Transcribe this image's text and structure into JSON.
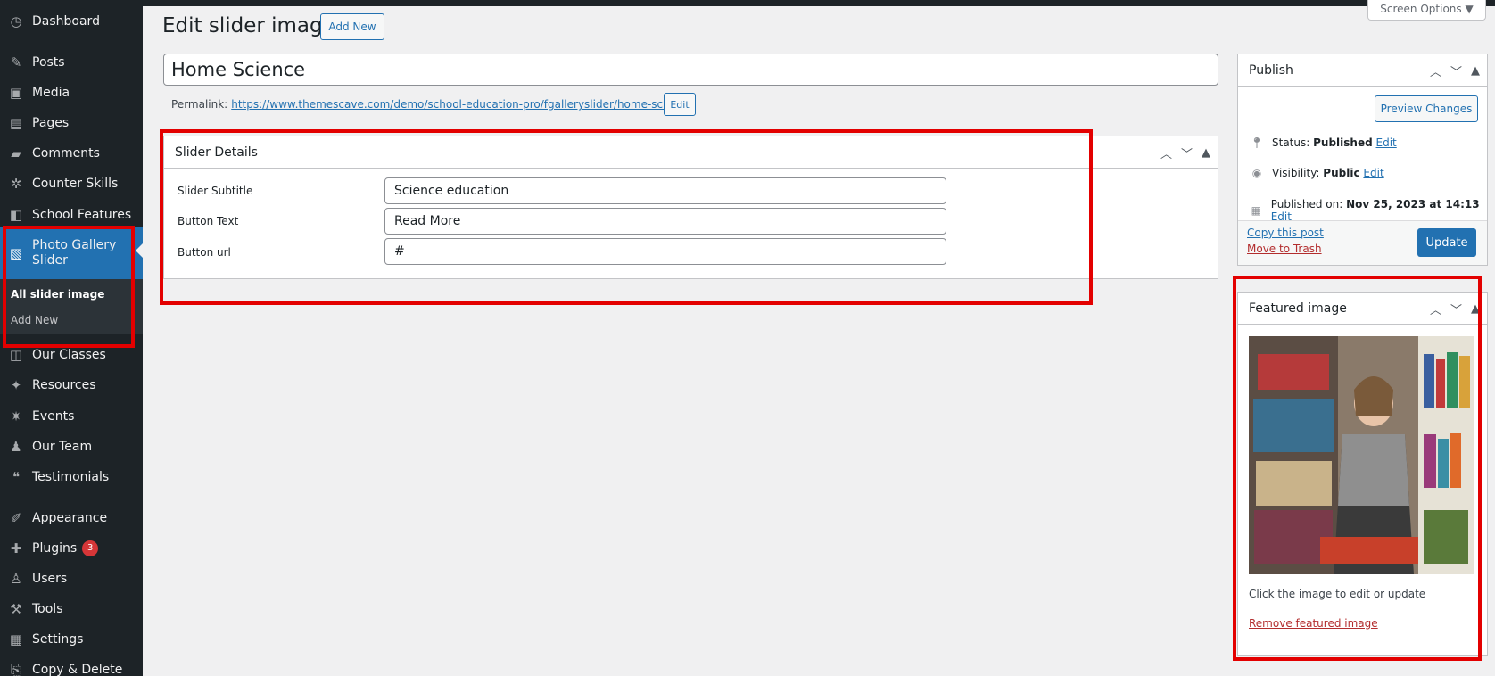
{
  "sidebar": {
    "items": [
      {
        "label": "Dashboard",
        "icon": "dashboard-icon",
        "glyph": "◷"
      },
      {
        "label": "Posts",
        "icon": "pin-icon",
        "glyph": "✎"
      },
      {
        "label": "Media",
        "icon": "media-icon",
        "glyph": "▣"
      },
      {
        "label": "Pages",
        "icon": "pages-icon",
        "glyph": "▤"
      },
      {
        "label": "Comments",
        "icon": "comment-icon",
        "glyph": "▰"
      },
      {
        "label": "Counter Skills",
        "icon": "skills-icon",
        "glyph": "✲"
      },
      {
        "label": "School Features",
        "icon": "features-icon",
        "glyph": "◧"
      },
      {
        "label": "Photo Gallery Slider",
        "icon": "gallery-icon",
        "glyph": "▧"
      },
      {
        "label": "Our Classes",
        "icon": "classes-icon",
        "glyph": "◫"
      },
      {
        "label": "Resources",
        "icon": "resources-icon",
        "glyph": "✦"
      },
      {
        "label": "Events",
        "icon": "events-icon",
        "glyph": "✷"
      },
      {
        "label": "Our Team",
        "icon": "team-icon",
        "glyph": "♟"
      },
      {
        "label": "Testimonials",
        "icon": "quote-icon",
        "glyph": "❝"
      },
      {
        "label": "Appearance",
        "icon": "appearance-icon",
        "glyph": "✐"
      },
      {
        "label": "Plugins",
        "icon": "plugins-icon",
        "glyph": "✚",
        "badge": "3"
      },
      {
        "label": "Users",
        "icon": "users-icon",
        "glyph": "♙"
      },
      {
        "label": "Tools",
        "icon": "tools-icon",
        "glyph": "⚒"
      },
      {
        "label": "Settings",
        "icon": "settings-icon",
        "glyph": "▦"
      },
      {
        "label": "Copy & Delete",
        "icon": "copy-icon",
        "glyph": "⎘"
      }
    ],
    "submenu": {
      "all_label": "All slider image",
      "add_label": "Add New"
    }
  },
  "header": {
    "title": "Edit slider image",
    "add_new": "Add New",
    "screen_options": "Screen Options ▼"
  },
  "post": {
    "title": "Home Science",
    "permalink_label": "Permalink:",
    "permalink_url": "https://www.themescave.com/demo/school-education-pro/fgalleryslider/home-science/",
    "permalink_edit": "Edit"
  },
  "slider_details": {
    "heading": "Slider Details",
    "fields": [
      {
        "label": "Slider Subtitle",
        "value": "Science education"
      },
      {
        "label": "Button Text",
        "value": "Read More"
      },
      {
        "label": "Button url",
        "value": "#"
      }
    ]
  },
  "publish": {
    "heading": "Publish",
    "preview": "Preview Changes",
    "status_label": "Status:",
    "status_value": "Published",
    "visibility_label": "Visibility:",
    "visibility_value": "Public",
    "published_label": "Published on:",
    "published_value": "Nov 25, 2023 at 14:13",
    "edit": "Edit",
    "copy_post": "Copy this post",
    "trash": "Move to Trash",
    "update": "Update"
  },
  "featured": {
    "heading": "Featured image",
    "hint": "Click the image to edit or update",
    "remove": "Remove featured image"
  },
  "colors": {
    "highlight_box": "#e30000",
    "accent": "#2271b1",
    "sidebar": "#1d2327"
  }
}
